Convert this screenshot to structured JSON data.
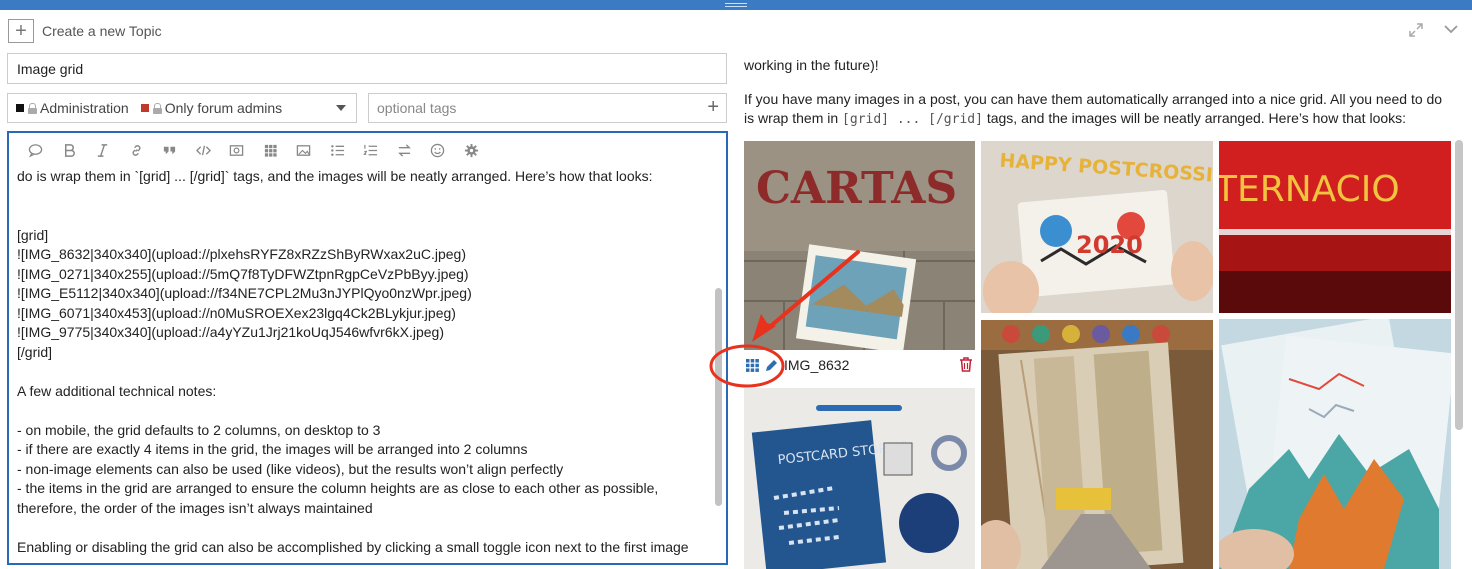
{
  "colors": {
    "accent": "#3a7bc4",
    "focus_border": "#2a6ab5",
    "annotation": "#e8321e",
    "admin_cat": "#111111",
    "forum_cat": "#c0392b"
  },
  "header": {
    "title": "Create a new Topic",
    "plus_icon": "plus-icon",
    "expand_icon": "expand-icon",
    "collapse_icon": "chevron-down-icon"
  },
  "title_field": {
    "value": "Image grid"
  },
  "category": {
    "parent": "Administration",
    "child": "Only forum admins"
  },
  "tags": {
    "placeholder": "optional tags"
  },
  "toolbar": [
    "speech-bubble-icon",
    "bold-icon",
    "italic-icon",
    "link-icon",
    "quote-icon",
    "code-icon",
    "image-icon",
    "grid-icon",
    "picture-icon",
    "bullet-list-icon",
    "numbered-list-icon",
    "swap-icon",
    "emoji-icon",
    "gear-icon"
  ],
  "editor": {
    "lines": [
      "do is wrap them in `[grid] ... [/grid]` tags, and the images will be neatly arranged. Here’s how that looks:",
      "",
      "",
      "[grid]",
      "![IMG_8632|340x340](upload://plxehsRYFZ8xRZzShByRWxax2uC.jpeg)",
      "![IMG_0271|340x255](upload://5mQ7f8TyDFWZtpnRgpCeVzPbByy.jpeg)",
      "![IMG_E5112|340x340](upload://f34NE7CPL2Mu3nJYPlQyo0nzWpr.jpeg)",
      "![IMG_6071|340x453](upload://n0MuSROEXex23lgq4Ck2BLykjur.jpeg)",
      "![IMG_9775|340x340](upload://a4yYZu1Jrj21koUqJ546wfvr6kX.jpeg)",
      "[/grid]",
      "",
      "A few additional technical notes:",
      "",
      "- on mobile, the grid defaults to 2 columns, on desktop to 3",
      "- if there are exactly 4 items in the grid, the images will be arranged into 2 columns",
      "- non-image elements can also be used (like videos), but the results won’t align perfectly",
      "- the items in the grid are arranged to ensure the column heights are as close to each other as possible,",
      "therefore, the order of the images isn’t always maintained",
      "",
      "Enabling or disabling the grid can also be accomplished by clicking a small toggle icon next to the first image"
    ]
  },
  "preview": {
    "line1": "working in the future)!",
    "para_a": "If you have many images in a post, you can have them automatically arranged into a nice grid. All you need to do is wrap them in ",
    "code": "[grid] ... [/grid]",
    "para_b": " tags, and the images will be neatly arranged. Here’s how that looks:",
    "caption": "IMG_8632",
    "image_texts": {
      "cartas": "CARTAS",
      "happy": "HAPPY POSTCROSSING",
      "year": "2020",
      "ternacio": "TERNACIO",
      "postcard_stories": "POSTCARD STORIES"
    }
  }
}
